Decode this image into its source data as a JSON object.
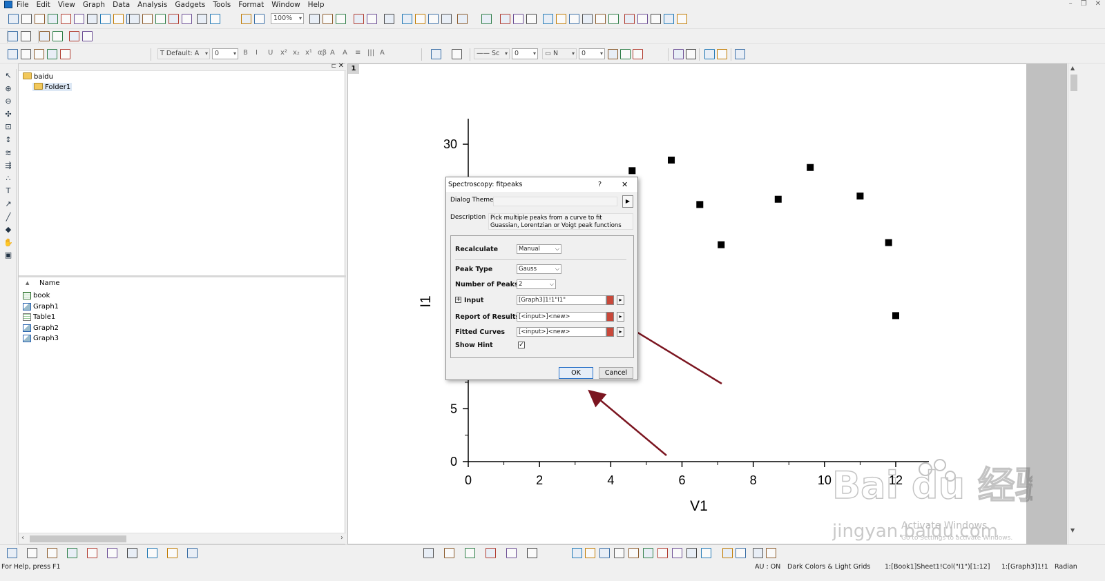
{
  "menu": [
    "File",
    "Edit",
    "View",
    "Graph",
    "Data",
    "Analysis",
    "Gadgets",
    "Tools",
    "Format",
    "Window",
    "Help"
  ],
  "toolbar": {
    "zoom": "100%",
    "font": "Default: A",
    "font_size": "0",
    "line_style": "Sc",
    "line_width": "0",
    "fill_pattern": "N",
    "fill_size": "0"
  },
  "explorer": {
    "root": "baidu",
    "folder": "Folder1",
    "column_header": "Name",
    "items": [
      {
        "label": "book",
        "icon": "workbook-icon"
      },
      {
        "label": "Graph1",
        "icon": "graph-icon"
      },
      {
        "label": "Table1",
        "icon": "table-icon"
      },
      {
        "label": "Graph2",
        "icon": "graph-icon"
      },
      {
        "label": "Graph3",
        "icon": "graph-icon"
      }
    ]
  },
  "graph": {
    "layer_label": "1",
    "xlabel": "V1",
    "ylabel": "I1",
    "xticks": [
      "0",
      "2",
      "4",
      "6",
      "8",
      "10",
      "12"
    ],
    "yticks": [
      "0",
      "5",
      "30"
    ]
  },
  "chart_data": {
    "type": "scatter",
    "xlabel": "V1",
    "ylabel": "I1",
    "xlim": [
      0,
      12
    ],
    "ylim": [
      0,
      32
    ],
    "x": [
      4.6,
      5.7,
      6.5,
      7.1,
      8.7,
      9.6,
      11.0,
      11.8,
      12.0
    ],
    "y": [
      27.5,
      28.5,
      24.3,
      20.5,
      24.8,
      27.8,
      25.1,
      20.7,
      13.8
    ]
  },
  "dialog": {
    "title": "Spectroscopy: fitpeaks",
    "help": "?",
    "close": "✕",
    "theme_label": "Dialog Theme",
    "theme_value": "",
    "desc_label": "Description",
    "desc_text": "Pick multiple peaks from a curve to fit Guassian, Lorentzian or Voigt peak functions",
    "recalculate_label": "Recalculate",
    "recalculate_value": "Manual",
    "peak_type_label": "Peak Type",
    "peak_type_value": "Gauss",
    "num_peaks_label": "Number of Peaks",
    "num_peaks_value": "2",
    "input_label": "Input",
    "input_value": "[Graph3]1!1\"I1\"",
    "report_label": "Report of Results",
    "report_value": "[<input>]<new>",
    "fitted_label": "Fitted Curves",
    "fitted_value": "[<input>]<new>",
    "hint_label": "Show Hint",
    "ok": "OK",
    "cancel": "Cancel"
  },
  "status": {
    "help": "For Help, press F1",
    "au": "AU : ON",
    "theme": "Dark Colors & Light Grids",
    "col": "1:[Book1]Sheet1!Col(\"I1\")[1:12]",
    "graph": "1:[Graph3]1!1",
    "angle": "Radian"
  },
  "watermark": {
    "logo": "Bai du 经验",
    "site": "jingyan.baidu.com",
    "activate": "Activate Windows",
    "activate_sub": "Go to Settings to activate Windows."
  },
  "colors": {
    "arrow": "#7b1520",
    "accent": "#1a6fc4"
  }
}
